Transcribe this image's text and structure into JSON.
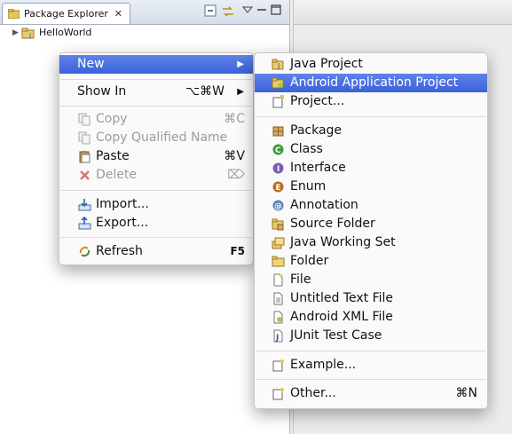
{
  "package_explorer": {
    "tab_label": "Package Explorer",
    "close_glyph": "✕",
    "tree": [
      {
        "label": "HelloWorld",
        "icon": "java-project-icon",
        "expanded": false
      }
    ]
  },
  "context_menu": {
    "items": [
      {
        "label": "New",
        "has_submenu": true,
        "highlighted": true
      },
      {
        "label": "Show In",
        "shortcut": "⌥⌘W",
        "has_submenu": true
      },
      {
        "label": "Copy",
        "shortcut": "⌘C",
        "icon": "copy-icon",
        "disabled": true
      },
      {
        "label": "Copy Qualified Name",
        "icon": "copy-qualified-name-icon",
        "disabled": true
      },
      {
        "label": "Paste",
        "shortcut": "⌘V",
        "icon": "paste-icon"
      },
      {
        "label": "Delete",
        "shortcut": "⌦",
        "icon": "delete-icon",
        "disabled": true
      },
      {
        "label": "Import...",
        "icon": "import-icon"
      },
      {
        "label": "Export...",
        "icon": "export-icon"
      },
      {
        "label": "Refresh",
        "shortcut": "F5",
        "icon": "refresh-icon"
      }
    ],
    "submenu_arrow": "▶"
  },
  "new_submenu": {
    "items": [
      {
        "label": "Java Project",
        "icon": "java-project-icon"
      },
      {
        "label": "Android Application Project",
        "icon": "android-project-icon",
        "highlighted": true
      },
      {
        "label": "Project...",
        "icon": "project-icon"
      },
      {
        "label": "Package",
        "icon": "package-icon"
      },
      {
        "label": "Class",
        "icon": "class-icon"
      },
      {
        "label": "Interface",
        "icon": "interface-icon"
      },
      {
        "label": "Enum",
        "icon": "enum-icon"
      },
      {
        "label": "Annotation",
        "icon": "annotation-icon"
      },
      {
        "label": "Source Folder",
        "icon": "source-folder-icon"
      },
      {
        "label": "Java Working Set",
        "icon": "working-set-icon"
      },
      {
        "label": "Folder",
        "icon": "folder-icon"
      },
      {
        "label": "File",
        "icon": "file-icon"
      },
      {
        "label": "Untitled Text File",
        "icon": "text-file-icon"
      },
      {
        "label": "Android XML File",
        "icon": "android-xml-icon"
      },
      {
        "label": "JUnit Test Case",
        "icon": "junit-icon"
      },
      {
        "label": "Example...",
        "icon": "example-icon"
      },
      {
        "label": "Other...",
        "shortcut": "⌘N",
        "icon": "other-wizard-icon"
      }
    ]
  },
  "colors": {
    "highlight": "#3a62d8",
    "disabled_text": "#9c9c9c"
  }
}
